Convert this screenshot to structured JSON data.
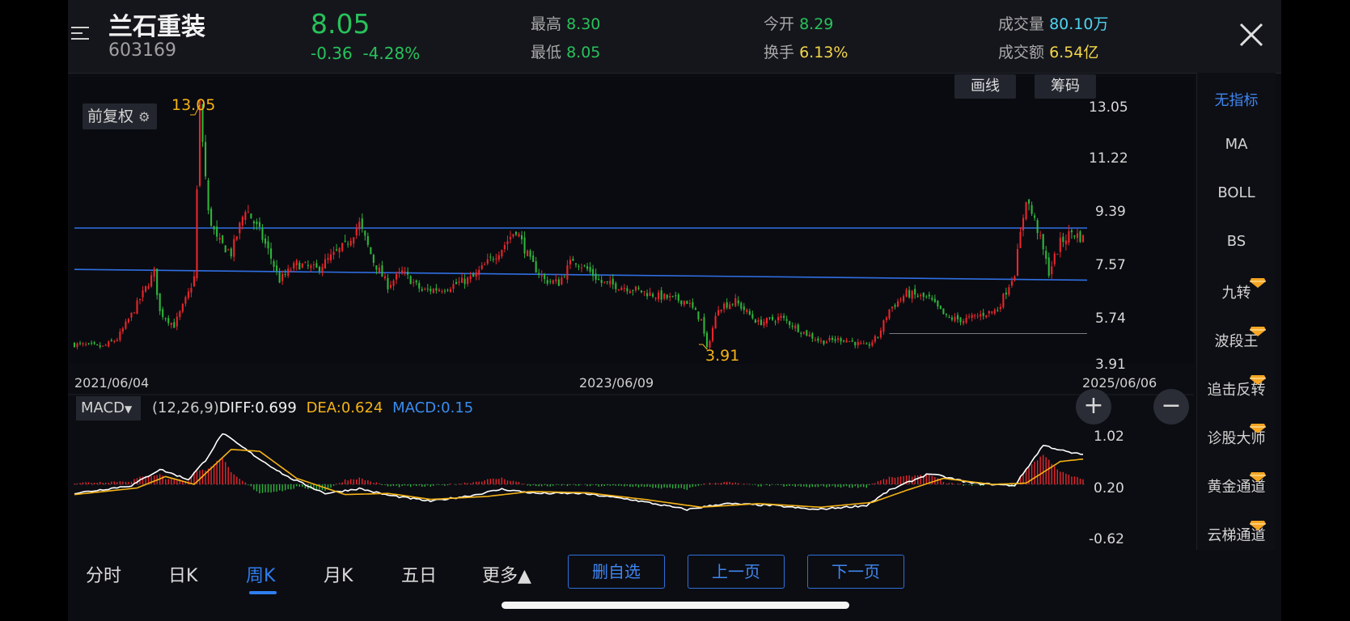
{
  "header": {
    "stock_name": "兰石重装",
    "stock_code": "603169",
    "price": "8.05",
    "change": "-0.36  -4.28%",
    "high_label": "最高",
    "high_value": "8.30",
    "low_label": "最低",
    "low_value": "8.05",
    "open_label": "今开",
    "open_value": "8.29",
    "turnover_label": "换手",
    "turnover_value": "6.13%",
    "volume_label": "成交量",
    "volume_value": "80.10万",
    "amount_label": "成交额",
    "amount_value": "6.54亿"
  },
  "toolbar": {
    "draw_label": "画线",
    "chips_label": "筹码"
  },
  "kline": {
    "adjust_label": "前复权",
    "max_label": "13.05",
    "min_label": "3.91",
    "y_ticks": [
      "13.05",
      "11.22",
      "9.39",
      "7.57",
      "5.74",
      "3.91"
    ],
    "x_dates": [
      "2021/06/04",
      "2023/06/09",
      "2025/06/06"
    ]
  },
  "macd": {
    "selector_label": "MACD",
    "params": "(12,26,9)",
    "diff": "DIFF:0.699",
    "dea": "DEA:0.624",
    "macd": "MACD:0.15",
    "y_ticks": [
      "1.02",
      "0.20",
      "-0.62"
    ]
  },
  "zoom": {
    "in": "+",
    "out": "−"
  },
  "indicators": [
    "无指标",
    "MA",
    "BOLL",
    "BS",
    "九转",
    "波段王",
    "追击反转",
    "诊股大师",
    "黄金通道",
    "云梯通道"
  ],
  "indicator_active": "无指标",
  "period_tabs": [
    "分时",
    "日K",
    "周K",
    "月K",
    "五日",
    "更多▲"
  ],
  "period_active": "周K",
  "buttons": {
    "remove": "删自选",
    "prev": "上一页",
    "next": "下一页"
  },
  "colors": {
    "up": "#e8262c",
    "down": "#2fb43c",
    "diff": "#ffffff",
    "dea": "#f5b316",
    "trendline": "#2f6fe4",
    "accent": "#2f7ef0"
  },
  "chart_data": {
    "type": "candlestick",
    "x_start": "2021/06/04",
    "x_end": "2025/06/06",
    "ylim": [
      3.91,
      13.05
    ],
    "price_points": [
      [
        0,
        4.1
      ],
      [
        10,
        4.0
      ],
      [
        15,
        4.3
      ],
      [
        20,
        5.2
      ],
      [
        25,
        6.2
      ],
      [
        28,
        6.8
      ],
      [
        30,
        5.3
      ],
      [
        35,
        4.8
      ],
      [
        38,
        5.5
      ],
      [
        40,
        6.0
      ],
      [
        42,
        6.6
      ],
      [
        44,
        13.05
      ],
      [
        47,
        9.0
      ],
      [
        50,
        8.0
      ],
      [
        55,
        7.5
      ],
      [
        60,
        9.2
      ],
      [
        65,
        8.3
      ],
      [
        68,
        7.6
      ],
      [
        72,
        6.5
      ],
      [
        78,
        7.1
      ],
      [
        85,
        6.9
      ],
      [
        95,
        7.8
      ],
      [
        100,
        8.6
      ],
      [
        105,
        7.2
      ],
      [
        110,
        6.3
      ],
      [
        115,
        6.8
      ],
      [
        122,
        6.1
      ],
      [
        130,
        6.2
      ],
      [
        140,
        6.6
      ],
      [
        150,
        7.7
      ],
      [
        155,
        8.4
      ],
      [
        160,
        7.2
      ],
      [
        165,
        6.5
      ],
      [
        170,
        6.4
      ],
      [
        175,
        7.3
      ],
      [
        180,
        6.9
      ],
      [
        185,
        6.4
      ],
      [
        195,
        6.2
      ],
      [
        205,
        5.9
      ],
      [
        215,
        5.7
      ],
      [
        220,
        5.0
      ],
      [
        222,
        3.91
      ],
      [
        226,
        5.5
      ],
      [
        232,
        5.7
      ],
      [
        240,
        4.9
      ],
      [
        248,
        5.1
      ],
      [
        255,
        4.6
      ],
      [
        262,
        4.2
      ],
      [
        270,
        4.3
      ],
      [
        278,
        4.0
      ],
      [
        282,
        4.4
      ],
      [
        286,
        5.4
      ],
      [
        292,
        6.0
      ],
      [
        300,
        5.8
      ],
      [
        306,
        5.1
      ],
      [
        312,
        5.0
      ],
      [
        318,
        5.2
      ],
      [
        324,
        5.4
      ],
      [
        330,
        6.8
      ],
      [
        334,
        9.6
      ],
      [
        338,
        8.4
      ],
      [
        342,
        6.8
      ],
      [
        346,
        7.9
      ],
      [
        350,
        8.3
      ],
      [
        354,
        8.05
      ]
    ],
    "trendlines": [
      [
        8.45,
        8.45
      ],
      [
        6.9,
        6.5
      ]
    ],
    "support_line": 4.5,
    "macd_ylim": [
      -0.62,
      1.02
    ],
    "diff_points": [
      [
        0,
        0.05
      ],
      [
        20,
        0.18
      ],
      [
        30,
        0.45
      ],
      [
        40,
        0.28
      ],
      [
        46,
        0.6
      ],
      [
        52,
        1.05
      ],
      [
        58,
        0.85
      ],
      [
        65,
        0.62
      ],
      [
        75,
        0.32
      ],
      [
        88,
        0.05
      ],
      [
        100,
        0.13
      ],
      [
        110,
        0.02
      ],
      [
        125,
        -0.08
      ],
      [
        140,
        0.02
      ],
      [
        150,
        0.12
      ],
      [
        162,
        0.05
      ],
      [
        178,
        0.05
      ],
      [
        195,
        -0.05
      ],
      [
        215,
        -0.22
      ],
      [
        228,
        -0.12
      ],
      [
        245,
        -0.15
      ],
      [
        260,
        -0.22
      ],
      [
        278,
        -0.15
      ],
      [
        286,
        0.1
      ],
      [
        300,
        0.38
      ],
      [
        315,
        0.22
      ],
      [
        330,
        0.18
      ],
      [
        340,
        0.85
      ],
      [
        350,
        0.72
      ],
      [
        354,
        0.7
      ]
    ],
    "dea_points": [
      [
        0,
        0.03
      ],
      [
        22,
        0.14
      ],
      [
        32,
        0.33
      ],
      [
        42,
        0.2
      ],
      [
        55,
        0.78
      ],
      [
        65,
        0.75
      ],
      [
        78,
        0.3
      ],
      [
        95,
        0.03
      ],
      [
        110,
        0.05
      ],
      [
        125,
        -0.05
      ],
      [
        145,
        0.0
      ],
      [
        160,
        0.08
      ],
      [
        180,
        0.06
      ],
      [
        200,
        -0.05
      ],
      [
        220,
        -0.18
      ],
      [
        240,
        -0.12
      ],
      [
        262,
        -0.18
      ],
      [
        280,
        -0.1
      ],
      [
        292,
        0.1
      ],
      [
        305,
        0.3
      ],
      [
        322,
        0.2
      ],
      [
        334,
        0.22
      ],
      [
        346,
        0.58
      ],
      [
        354,
        0.62
      ]
    ]
  }
}
